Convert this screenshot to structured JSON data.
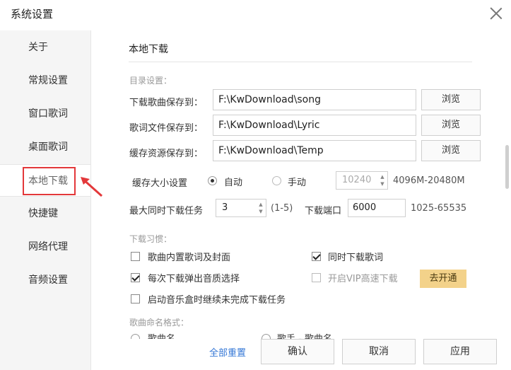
{
  "window": {
    "title": "系统设置"
  },
  "sidebar": {
    "items": [
      {
        "label": "关于"
      },
      {
        "label": "常规设置"
      },
      {
        "label": "窗口歌词"
      },
      {
        "label": "桌面歌词"
      },
      {
        "label": "本地下载",
        "active": true
      },
      {
        "label": "快捷键"
      },
      {
        "label": "网络代理"
      },
      {
        "label": "音频设置"
      }
    ]
  },
  "section": {
    "title": "本地下载"
  },
  "directory": {
    "group_label": "目录设置：",
    "rows": [
      {
        "label": "下载歌曲保存到：",
        "value": "F:\\KwDownload\\song",
        "button": "浏览"
      },
      {
        "label": "歌词文件保存到：",
        "value": "F:\\KwDownload\\Lyric",
        "button": "浏览"
      },
      {
        "label": "缓存资源保存到：",
        "value": "F:\\KwDownload\\Temp",
        "button": "浏览"
      }
    ]
  },
  "cache": {
    "label": "缓存大小设置",
    "auto_label": "自动",
    "manual_label": "手动",
    "selected": "自动",
    "size_value": "10240",
    "range_hint": "4096M-20480M"
  },
  "tasks": {
    "label": "最大同时下载任务",
    "value": "3",
    "range_hint": "(1-5)",
    "port_label": "下载端口",
    "port_value": "6000",
    "port_range": "1025-65535"
  },
  "habits": {
    "group_label": "下载习惯：",
    "options": [
      {
        "label": "歌曲内置歌词及封面",
        "checked": false
      },
      {
        "label": "同时下载歌词",
        "checked": true
      },
      {
        "label": "每次下载弹出音质选择",
        "checked": true
      },
      {
        "label": "开启VIP高速下载",
        "checked": false,
        "disabled": true
      },
      {
        "label": "启动音乐盒时继续未完成下载任务",
        "checked": false
      }
    ],
    "vip_button": "去开通"
  },
  "naming": {
    "group_label": "歌曲命名格式：",
    "option_1": "歌曲名",
    "option_2": "歌手 - 歌曲名"
  },
  "footer": {
    "reset": "全部重置",
    "confirm": "确认",
    "cancel": "取消",
    "apply": "应用"
  }
}
